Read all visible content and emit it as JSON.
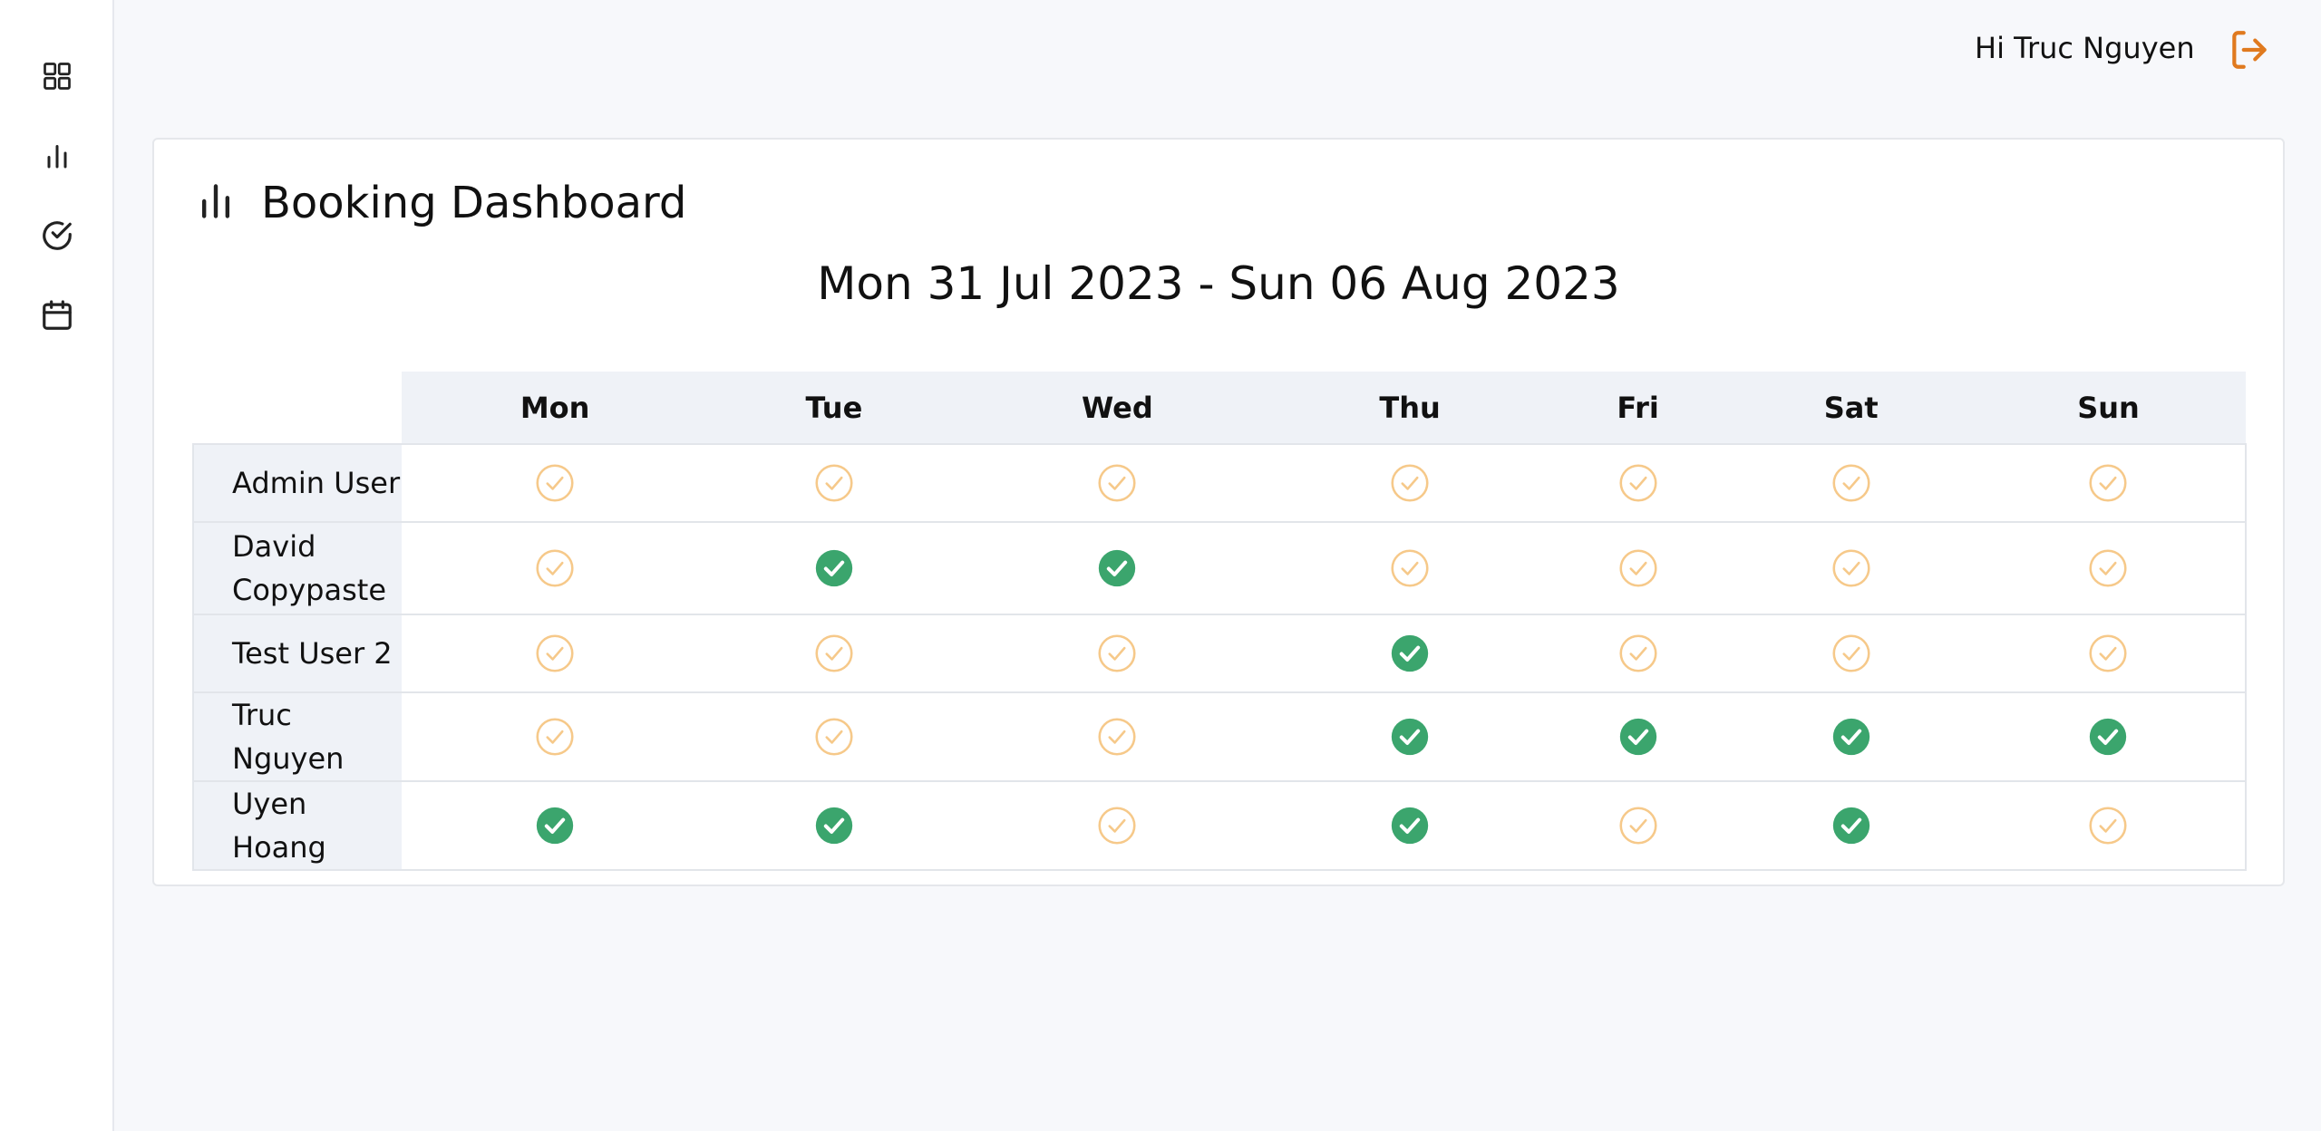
{
  "sidebar": {
    "items": [
      {
        "icon": "dashboard-grid-icon"
      },
      {
        "icon": "bar-chart-icon"
      },
      {
        "icon": "check-circle-icon"
      },
      {
        "icon": "calendar-icon"
      }
    ]
  },
  "header": {
    "greeting": "Hi Truc Nguyen",
    "logout_icon": "logout-icon",
    "accent_color": "#e07a1f"
  },
  "card": {
    "title": "Booking Dashboard",
    "date_range": "Mon 31 Jul 2023 - Sun 06 Aug 2023"
  },
  "table": {
    "days": [
      "Mon",
      "Tue",
      "Wed",
      "Thu",
      "Fri",
      "Sat",
      "Sun"
    ],
    "rows": [
      {
        "name": "Admin User",
        "booked": [
          false,
          false,
          false,
          false,
          false,
          false,
          false
        ]
      },
      {
        "name": "David Copypaste",
        "booked": [
          false,
          true,
          true,
          false,
          false,
          false,
          false
        ]
      },
      {
        "name": "Test User 2",
        "booked": [
          false,
          false,
          false,
          true,
          false,
          false,
          false
        ]
      },
      {
        "name": "Truc Nguyen",
        "booked": [
          false,
          false,
          false,
          true,
          true,
          true,
          true
        ]
      },
      {
        "name": "Uyen Hoang",
        "booked": [
          true,
          true,
          false,
          true,
          false,
          true,
          false
        ]
      }
    ],
    "colors": {
      "booked": "#3ba56d",
      "available": "#f6c98a"
    }
  }
}
